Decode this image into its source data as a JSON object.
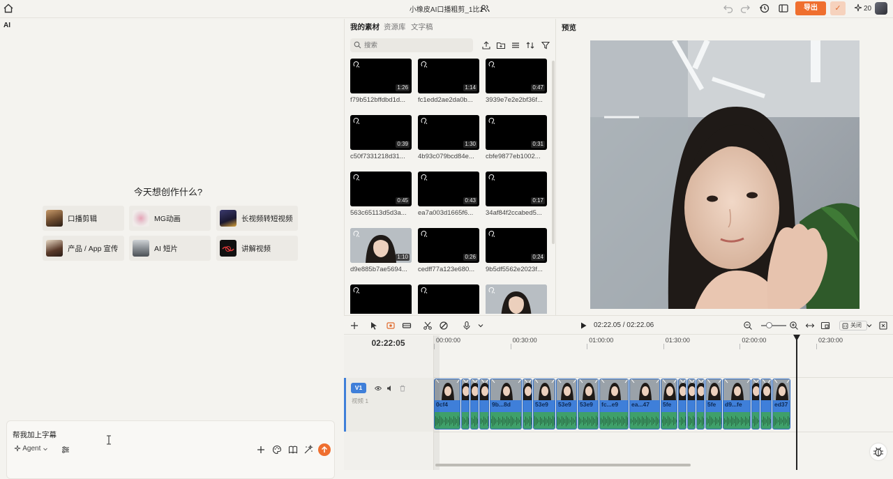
{
  "app": {
    "title": "小橡皮AI口播粗剪_1比1",
    "export_label": "导出",
    "credits": "20"
  },
  "ai_panel": {
    "title": "AI",
    "hero": "今天想创作什么?",
    "templates": [
      {
        "label": "口播剪辑"
      },
      {
        "label": "MG动画"
      },
      {
        "label": "长视频转短视频"
      },
      {
        "label": "产品 / App 宣传"
      },
      {
        "label": "AI 短片"
      },
      {
        "label": "讲解视频"
      }
    ],
    "chat": {
      "value": "帮我加上字幕",
      "agent_label": "Agent"
    }
  },
  "assets_panel": {
    "tabs": [
      "我的素材",
      "资源库",
      "文字稿"
    ],
    "search_placeholder": "搜索",
    "items": [
      {
        "name": "f79b512bffdbd1d...",
        "duration": "1:26"
      },
      {
        "name": "fc1edd2ae2da0b...",
        "duration": "1:14"
      },
      {
        "name": "3939e7e2e2bf36f...",
        "duration": "0:47"
      },
      {
        "name": "c50f7331218d31...",
        "duration": "0:39"
      },
      {
        "name": "4b93c079bcd84e...",
        "duration": "1:30"
      },
      {
        "name": "cbfe9877eb1002...",
        "duration": "0:31"
      },
      {
        "name": "563c65113d5d3a...",
        "duration": "0:45"
      },
      {
        "name": "ea7a003d1665f6...",
        "duration": "0:43"
      },
      {
        "name": "34af84f2ccabed5...",
        "duration": "0:17"
      },
      {
        "name": "d9e885b7ae5694...",
        "duration": "1:10"
      },
      {
        "name": "cedff77a123e680...",
        "duration": "0:26"
      },
      {
        "name": "9b5df5562e2023f...",
        "duration": "0:24"
      },
      {
        "name": "",
        "duration": ""
      },
      {
        "name": "",
        "duration": ""
      },
      {
        "name": "",
        "duration": ""
      }
    ]
  },
  "preview": {
    "title": "预览"
  },
  "timeline": {
    "timecode": "02:22.05 / 02:22.06",
    "current_time": "02:22:05",
    "snap_label": "关闭",
    "ruler": [
      "00:00:00",
      "00:30:00",
      "01:00:00",
      "01:30:00",
      "02:00:00",
      "02:30:00"
    ],
    "track": {
      "badge": "V1",
      "name": "视频 1"
    },
    "clips": [
      {
        "label": "0cf4"
      },
      {
        "label": ""
      },
      {
        "label": ""
      },
      {
        "label": ""
      },
      {
        "label": "9b...8d"
      },
      {
        "label": ""
      },
      {
        "label": "53e9"
      },
      {
        "label": "53e9"
      },
      {
        "label": "53e9"
      },
      {
        "label": "fc...e9"
      },
      {
        "label": "ea...47"
      },
      {
        "label": "5fe"
      },
      {
        "label": ""
      },
      {
        "label": ""
      },
      {
        "label": ""
      },
      {
        "label": "5fe"
      },
      {
        "label": "d9...fe"
      },
      {
        "label": ""
      },
      {
        "label": ""
      },
      {
        "label": "ed37"
      }
    ]
  }
}
